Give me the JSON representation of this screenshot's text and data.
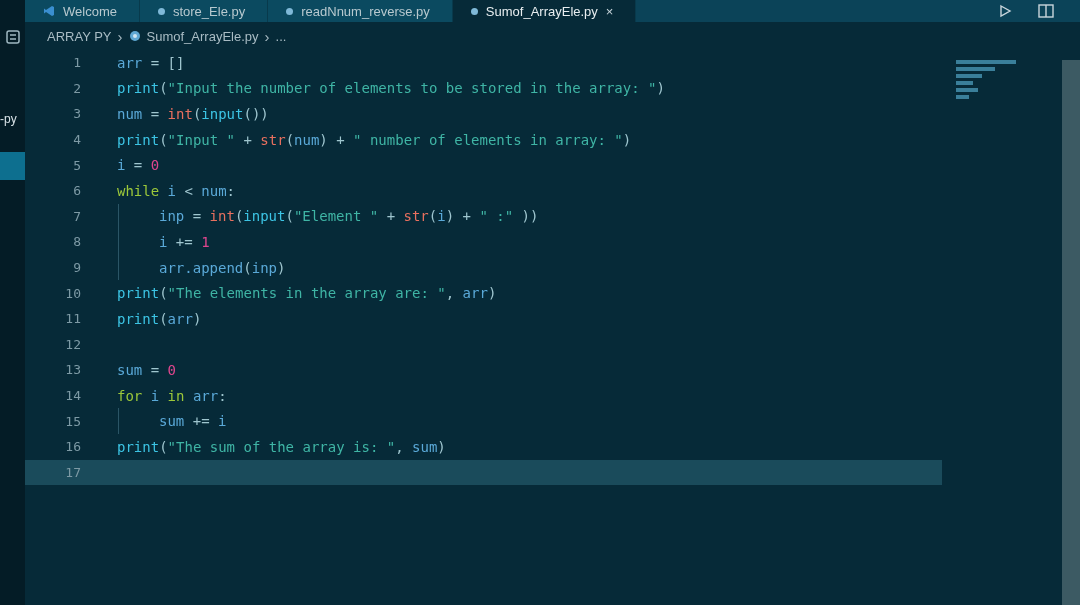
{
  "tabs": [
    {
      "label": "Welcome",
      "kind": "welcome",
      "selected": false
    },
    {
      "label": "store_Ele.py",
      "kind": "python",
      "selected": false
    },
    {
      "label": "readNnum_reverse.py",
      "kind": "python",
      "selected": false
    },
    {
      "label": "Sumof_ArrayEle.py",
      "kind": "python",
      "selected": true
    }
  ],
  "close_glyph": "×",
  "sidebar": {
    "label": "-py"
  },
  "breadcrumb": {
    "folder": "ARRAY PY",
    "separator_1": "›",
    "file": "Sumof_ArrayEle.py",
    "separator_2": "›",
    "rest": "..."
  },
  "lines": [
    {
      "number": "1",
      "current": false,
      "indent": false,
      "tokens": [
        {
          "t": "arr",
          "kind": "var"
        },
        {
          "t": " = ",
          "kind": "op"
        },
        {
          "t": "[]",
          "kind": "op"
        }
      ]
    },
    {
      "number": "2",
      "current": false,
      "indent": false,
      "tokens": [
        {
          "t": "print",
          "kind": "fn"
        },
        {
          "t": "(",
          "kind": "op"
        },
        {
          "t": "\"Input the number of elements to be stored in the array: \"",
          "kind": "str"
        },
        {
          "t": ")",
          "kind": "op"
        }
      ]
    },
    {
      "number": "3",
      "current": false,
      "indent": false,
      "tokens": [
        {
          "t": "num",
          "kind": "var"
        },
        {
          "t": " = ",
          "kind": "op"
        },
        {
          "t": "int",
          "kind": "type"
        },
        {
          "t": "(",
          "kind": "op"
        },
        {
          "t": "input",
          "kind": "fn"
        },
        {
          "t": "())",
          "kind": "op"
        }
      ]
    },
    {
      "number": "4",
      "current": false,
      "indent": false,
      "tokens": [
        {
          "t": "print",
          "kind": "fn"
        },
        {
          "t": "(",
          "kind": "op"
        },
        {
          "t": "\"Input \"",
          "kind": "str"
        },
        {
          "t": " + ",
          "kind": "op"
        },
        {
          "t": "str",
          "kind": "type"
        },
        {
          "t": "(",
          "kind": "op"
        },
        {
          "t": "num",
          "kind": "var"
        },
        {
          "t": ") + ",
          "kind": "op"
        },
        {
          "t": "\" number of elements in array: \"",
          "kind": "str"
        },
        {
          "t": ")",
          "kind": "op"
        }
      ]
    },
    {
      "number": "5",
      "current": false,
      "indent": false,
      "tokens": [
        {
          "t": "i",
          "kind": "var"
        },
        {
          "t": " = ",
          "kind": "op"
        },
        {
          "t": "0",
          "kind": "num"
        }
      ]
    },
    {
      "number": "6",
      "current": false,
      "indent": false,
      "tokens": [
        {
          "t": "while",
          "kind": "kw"
        },
        {
          "t": " i ",
          "kind": "var"
        },
        {
          "t": "< ",
          "kind": "op"
        },
        {
          "t": "num",
          "kind": "var"
        },
        {
          "t": ":",
          "kind": "op"
        }
      ]
    },
    {
      "number": "7",
      "current": false,
      "indent": true,
      "tokens": [
        {
          "t": "inp",
          "kind": "var"
        },
        {
          "t": " = ",
          "kind": "op"
        },
        {
          "t": "int",
          "kind": "type"
        },
        {
          "t": "(",
          "kind": "op"
        },
        {
          "t": "input",
          "kind": "fn"
        },
        {
          "t": "(",
          "kind": "op"
        },
        {
          "t": "\"Element \"",
          "kind": "str"
        },
        {
          "t": " + ",
          "kind": "op"
        },
        {
          "t": "str",
          "kind": "type"
        },
        {
          "t": "(",
          "kind": "op"
        },
        {
          "t": "i",
          "kind": "var"
        },
        {
          "t": ") + ",
          "kind": "op"
        },
        {
          "t": "\" :\"",
          "kind": "str"
        },
        {
          "t": " ))",
          "kind": "op"
        }
      ]
    },
    {
      "number": "8",
      "current": false,
      "indent": true,
      "tokens": [
        {
          "t": "i",
          "kind": "var"
        },
        {
          "t": " += ",
          "kind": "op"
        },
        {
          "t": "1",
          "kind": "num"
        }
      ]
    },
    {
      "number": "9",
      "current": false,
      "indent": true,
      "tokens": [
        {
          "t": "arr.append",
          "kind": "var"
        },
        {
          "t": "(",
          "kind": "op"
        },
        {
          "t": "inp",
          "kind": "var"
        },
        {
          "t": ")",
          "kind": "op"
        }
      ]
    },
    {
      "number": "10",
      "current": false,
      "indent": false,
      "tokens": [
        {
          "t": "print",
          "kind": "fn"
        },
        {
          "t": "(",
          "kind": "op"
        },
        {
          "t": "\"The elements in the array are: \"",
          "kind": "str"
        },
        {
          "t": ", ",
          "kind": "op"
        },
        {
          "t": "arr",
          "kind": "var"
        },
        {
          "t": ")",
          "kind": "op"
        }
      ]
    },
    {
      "number": "11",
      "current": false,
      "indent": false,
      "tokens": [
        {
          "t": "print",
          "kind": "fn"
        },
        {
          "t": "(",
          "kind": "op"
        },
        {
          "t": "arr",
          "kind": "var"
        },
        {
          "t": ")",
          "kind": "op"
        }
      ]
    },
    {
      "number": "12",
      "current": false,
      "indent": false
    },
    {
      "number": "13",
      "current": false,
      "indent": false,
      "tokens": [
        {
          "t": "sum",
          "kind": "var"
        },
        {
          "t": " = ",
          "kind": "op"
        },
        {
          "t": "0",
          "kind": "num"
        }
      ]
    },
    {
      "number": "14",
      "current": false,
      "indent": false,
      "tokens": [
        {
          "t": "for",
          "kind": "kw"
        },
        {
          "t": " i ",
          "kind": "var"
        },
        {
          "t": "in",
          "kind": "kw"
        },
        {
          "t": " arr",
          "kind": "var"
        },
        {
          "t": ":",
          "kind": "op"
        }
      ]
    },
    {
      "number": "15",
      "current": false,
      "indent": true,
      "tokens": [
        {
          "t": "sum",
          "kind": "var"
        },
        {
          "t": " += ",
          "kind": "op"
        },
        {
          "t": "i",
          "kind": "var"
        }
      ]
    },
    {
      "number": "16",
      "current": false,
      "indent": false,
      "tokens": [
        {
          "t": "print",
          "kind": "fn"
        },
        {
          "t": "(",
          "kind": "op"
        },
        {
          "t": "\"The sum of the array is: \"",
          "kind": "str"
        },
        {
          "t": ", ",
          "kind": "op"
        },
        {
          "t": "sum",
          "kind": "var"
        },
        {
          "t": ")",
          "kind": "op"
        }
      ]
    },
    {
      "number": "17",
      "current": true,
      "indent": false
    }
  ]
}
